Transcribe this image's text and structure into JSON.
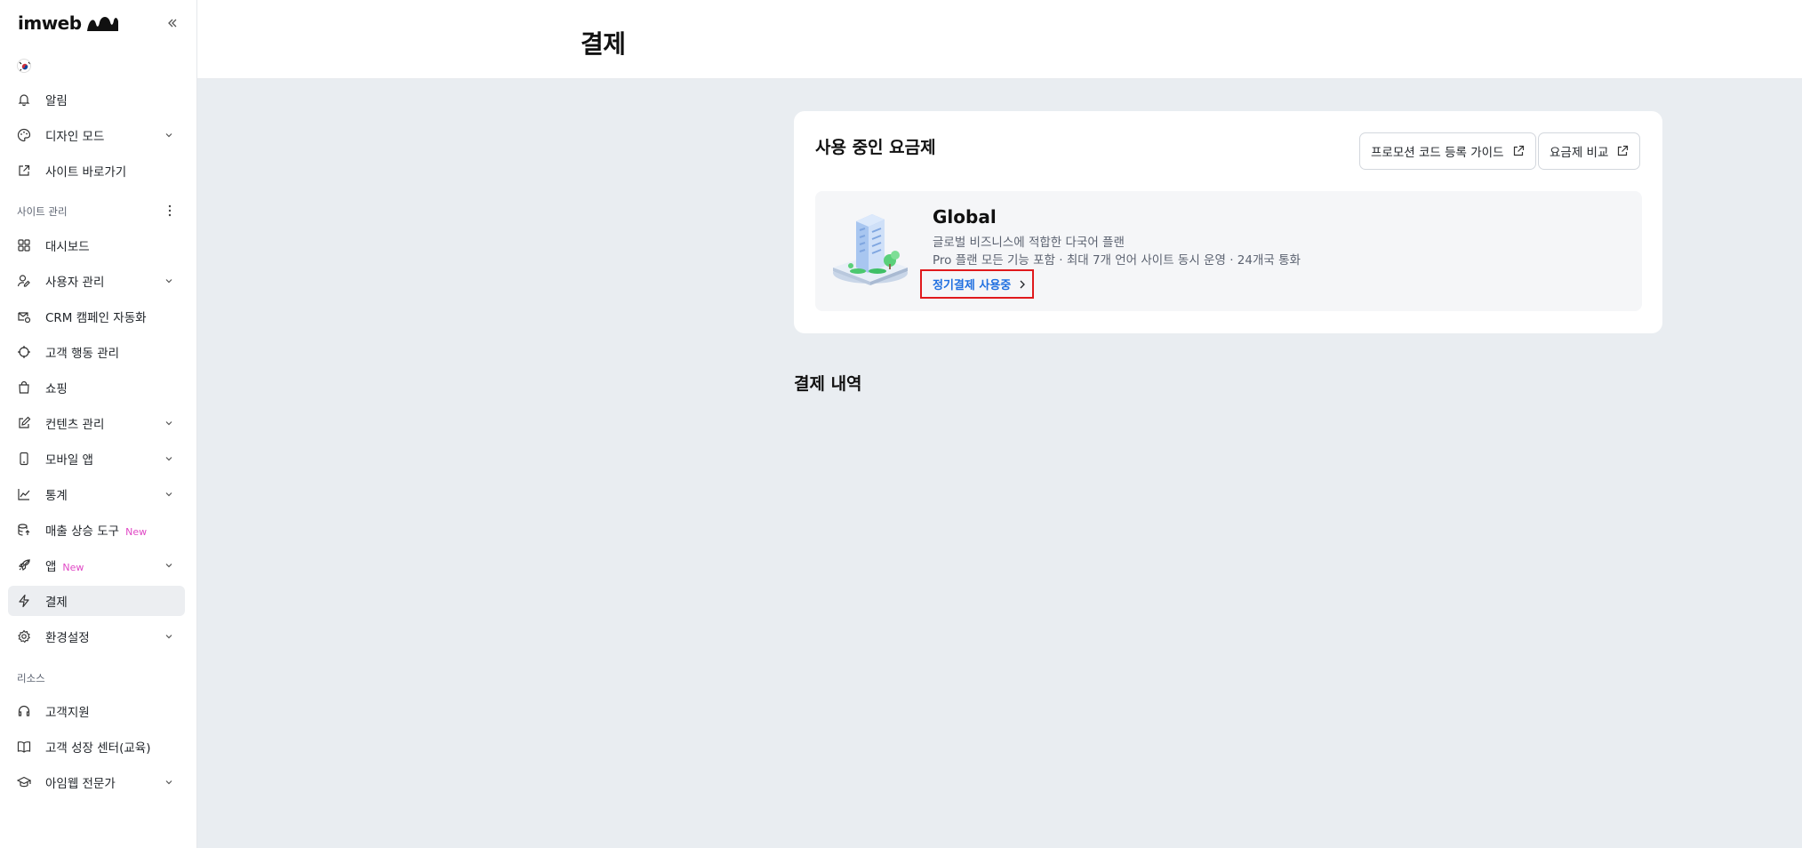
{
  "brand": {
    "name": "imweb",
    "accent": "#1f6fe0",
    "new_badge_color": "#e048c5",
    "highlight": "#e0191c"
  },
  "sidebar": {
    "top_items": [
      {
        "label": "알림",
        "icon": "bell-icon"
      },
      {
        "label": "디자인 모드",
        "icon": "palette-icon",
        "expandable": true
      },
      {
        "label": "사이트 바로가기",
        "icon": "external-link-icon"
      }
    ],
    "site_section": "사이트 관리",
    "site_items": [
      {
        "label": "대시보드",
        "icon": "grid-icon"
      },
      {
        "label": "사용자 관리",
        "icon": "user-edit-icon",
        "expandable": true
      },
      {
        "label": "CRM 캠페인 자동화",
        "icon": "mail-automation-icon"
      },
      {
        "label": "고객 행동 관리",
        "icon": "target-icon"
      },
      {
        "label": "쇼핑",
        "icon": "shopping-bag-icon"
      },
      {
        "label": "컨텐츠 관리",
        "icon": "pencil-square-icon",
        "expandable": true
      },
      {
        "label": "모바일 앱",
        "icon": "mobile-icon",
        "expandable": true
      },
      {
        "label": "통계",
        "icon": "chart-line-icon",
        "expandable": true
      },
      {
        "label": "매출 상승 도구",
        "icon": "growth-tool-icon",
        "badge": "New"
      },
      {
        "label": "앱",
        "icon": "rocket-icon",
        "badge": "New",
        "expandable": true
      },
      {
        "label": "결제",
        "icon": "lightning-icon",
        "active": true
      },
      {
        "label": "환경설정",
        "icon": "gear-icon",
        "expandable": true
      }
    ],
    "resource_section": "리소스",
    "resource_items": [
      {
        "label": "고객지원",
        "icon": "headset-icon"
      },
      {
        "label": "고객 성장 센터(교육)",
        "icon": "book-icon"
      },
      {
        "label": "아임웹 전문가",
        "icon": "graduation-cap-icon",
        "expandable": true
      }
    ]
  },
  "header": {
    "title": "결제"
  },
  "plan_card": {
    "title": "사용 중인 요금제",
    "promo_button": "프로모션 코드 등록 가이드",
    "compare_button": "요금제 비교",
    "plan_name": "Global",
    "plan_description": "글로벌 비즈니스에 적합한 다국어 플랜",
    "plan_features": "Pro 플랜 모든 기능 포함 · 최대 7개 언어 사이트 동시 운영 · 24개국 통화",
    "subscription_link": "정기결제 사용중"
  },
  "history": {
    "title": "결제 내역"
  }
}
